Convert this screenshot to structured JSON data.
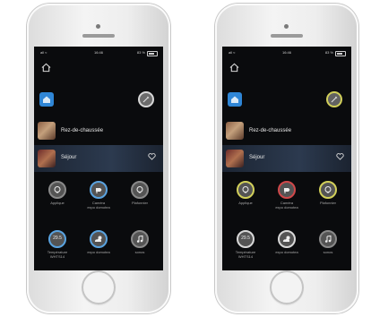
{
  "colors": {
    "accent_blue": "#2f86d6",
    "ring_grey": "#8a8a8a",
    "ring_blue": "#5aa3e0",
    "ring_yellow": "#d2d05a",
    "ring_red": "#d0484a",
    "ring_white": "#d8d8d8"
  },
  "phones": [
    {
      "status": {
        "signal": "all ≈",
        "time": "16:46",
        "battery": "83 %"
      },
      "rooms": {
        "rdc": "Rez-de-chaussée",
        "sejour": "Séjour"
      },
      "devices": [
        {
          "label": "Applique",
          "icon": "lightbulb-icon",
          "ring": "#8a8a8a"
        },
        {
          "label": "Caméra\nexpo domotea",
          "icon": "camera-icon",
          "ring": "#5aa3e0"
        },
        {
          "label": "Plafonnier",
          "icon": "lightbulb-icon",
          "ring": "#8a8a8a"
        },
        {
          "label": "Température\nWHTS14",
          "icon": "thermometer-icon",
          "value": "29.5",
          "ring": "#5aa3e0"
        },
        {
          "label": "expo domotea",
          "icon": "weather-icon",
          "ring": "#5aa3e0"
        },
        {
          "label": "sonos",
          "icon": "music-note-icon",
          "ring": "#8a8a8a"
        }
      ]
    },
    {
      "status": {
        "signal": "all ≈",
        "time": "16:46",
        "battery": "83 %"
      },
      "rooms": {
        "rdc": "Rez-de-chaussée",
        "sejour": "Séjour"
      },
      "devices": [
        {
          "label": "Applique",
          "icon": "lightbulb-icon",
          "ring": "#d2d05a"
        },
        {
          "label": "Caméra\nexpo domotea",
          "icon": "camera-icon",
          "ring": "#d0484a"
        },
        {
          "label": "Plafonnier",
          "icon": "lightbulb-icon",
          "ring": "#d2d05a"
        },
        {
          "label": "Température\nWHTS14",
          "icon": "thermometer-icon",
          "value": "29.5",
          "ring": "#d8d8d8"
        },
        {
          "label": "expo domotea",
          "icon": "weather-icon",
          "ring": "#d8d8d8"
        },
        {
          "label": "sonos",
          "icon": "music-note-icon",
          "ring": "#8a8a8a"
        }
      ]
    }
  ]
}
